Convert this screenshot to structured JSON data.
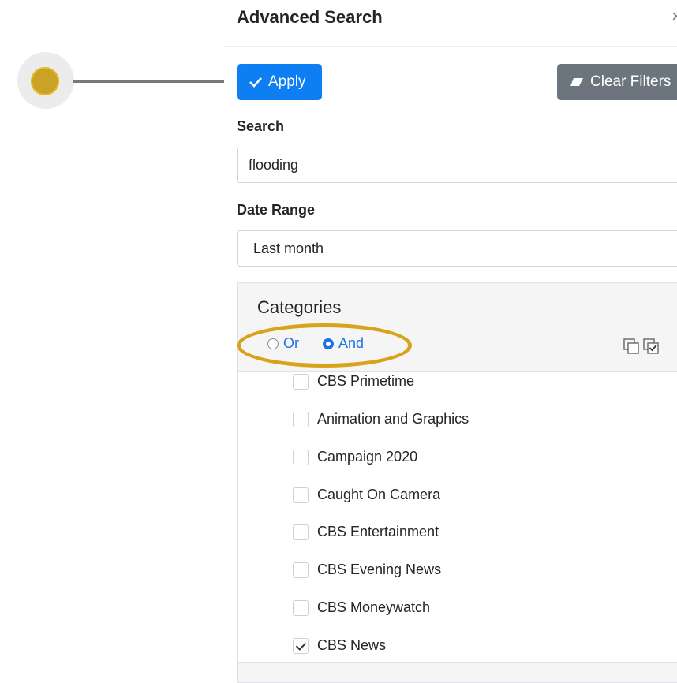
{
  "panel": {
    "title": "Advanced Search",
    "close_glyph": "×"
  },
  "toolbar": {
    "apply_label": "Apply",
    "apply_icon": "check-icon",
    "clear_label": "Clear Filters",
    "clear_icon": "eraser-icon"
  },
  "search": {
    "label": "Search",
    "value": "flooding"
  },
  "date_range": {
    "label": "Date Range",
    "value": "Last month"
  },
  "categories": {
    "title": "Categories",
    "logic_options": [
      {
        "label": "Or",
        "checked": false
      },
      {
        "label": "And",
        "checked": true
      }
    ],
    "items": [
      {
        "label": "CBS Primetime",
        "checked": false
      },
      {
        "label": "Animation and Graphics",
        "checked": false
      },
      {
        "label": "Campaign 2020",
        "checked": false
      },
      {
        "label": "Caught On Camera",
        "checked": false
      },
      {
        "label": "CBS Entertainment",
        "checked": false
      },
      {
        "label": "CBS Evening News",
        "checked": false
      },
      {
        "label": "CBS Moneywatch",
        "checked": false
      },
      {
        "label": "CBS News",
        "checked": true
      }
    ]
  },
  "colors": {
    "primary": "#0d7ff3",
    "secondary": "#6c757d",
    "annotation": "#d9a21b"
  }
}
